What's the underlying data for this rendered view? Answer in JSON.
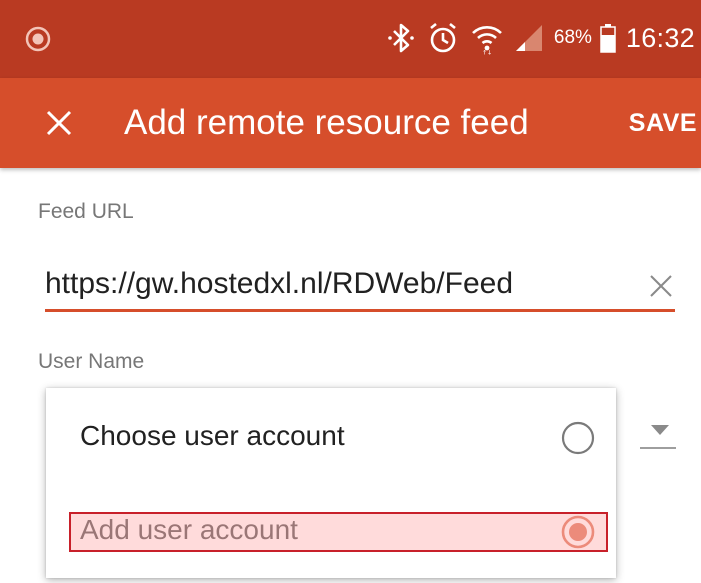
{
  "status_bar": {
    "battery_percent": "68%",
    "time": "16:32",
    "icons": [
      "app-notification-icon",
      "bluetooth-icon",
      "alarm-icon",
      "wifi-icon",
      "cell-signal-icon",
      "battery-icon"
    ]
  },
  "app_bar": {
    "title": "Add remote resource feed",
    "save_label": "SAVE",
    "close_icon": "close-icon"
  },
  "form": {
    "feed_url_label": "Feed URL",
    "feed_url_value": "https://gw.hostedxl.nl/RDWeb/Feed",
    "user_name_label": "User Name"
  },
  "user_menu": {
    "items": [
      {
        "label": "Choose user account",
        "selected": false
      },
      {
        "label": "Add user account",
        "selected": true
      }
    ]
  },
  "colors": {
    "status_bar": "#b93a22",
    "app_bar": "#d64e2b",
    "accent": "#d64e2b",
    "highlight_border": "#c8202a"
  }
}
